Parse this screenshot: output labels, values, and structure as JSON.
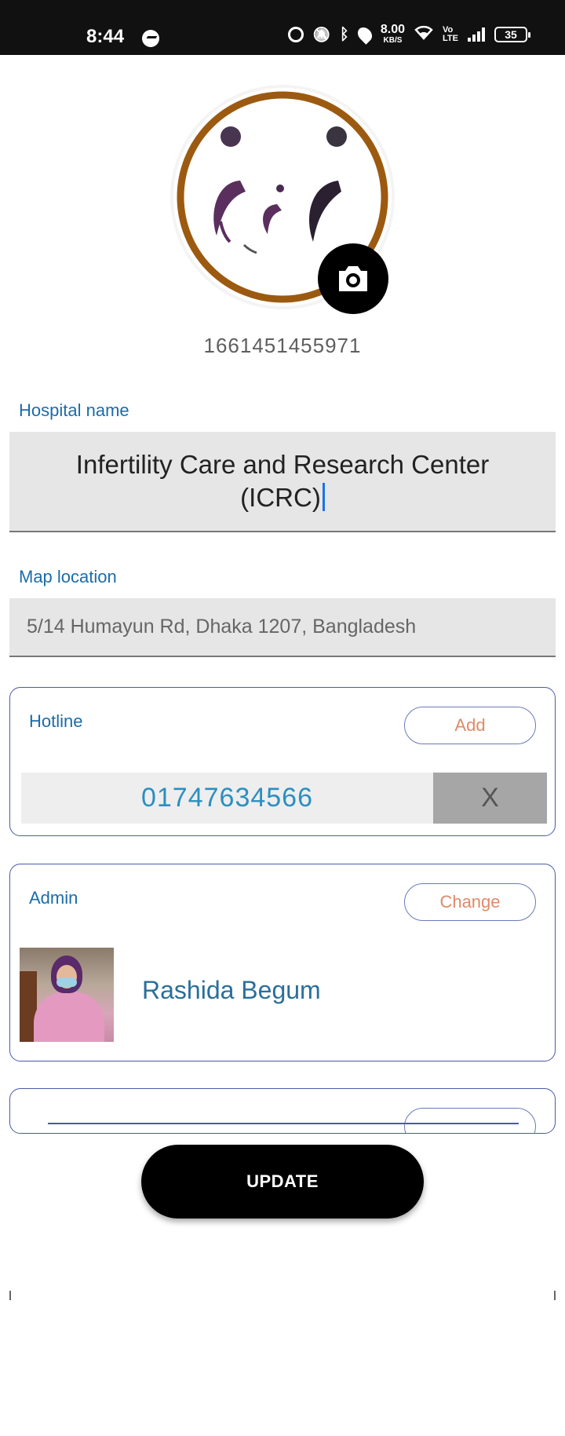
{
  "status_bar": {
    "time": "8:44",
    "speed_value": "8.00",
    "speed_unit": "KB/S",
    "volte_top": "Vo",
    "volte_bottom": "LTE",
    "battery": "35"
  },
  "profile": {
    "logo_icon": "icrc-logo",
    "camera_icon": "camera-icon",
    "user_id": "1661451455971"
  },
  "hospital": {
    "label": "Hospital name",
    "value": "Infertility Care and Research Center (ICRC)"
  },
  "map": {
    "label": "Map location",
    "value": "5/14 Humayun Rd, Dhaka 1207, Bangladesh"
  },
  "hotline": {
    "title": "Hotline",
    "add_label": "Add",
    "numbers": [
      "01747634566"
    ],
    "remove_label": "X"
  },
  "admin": {
    "title": "Admin",
    "change_label": "Change",
    "name": "Rashida Begum"
  },
  "update_label": "UPDATE",
  "colors": {
    "accent_blue": "#1b6ca8",
    "button_text": "#e08a68",
    "card_border": "#4a5aa8",
    "logo_ring": "#9c5a10"
  }
}
